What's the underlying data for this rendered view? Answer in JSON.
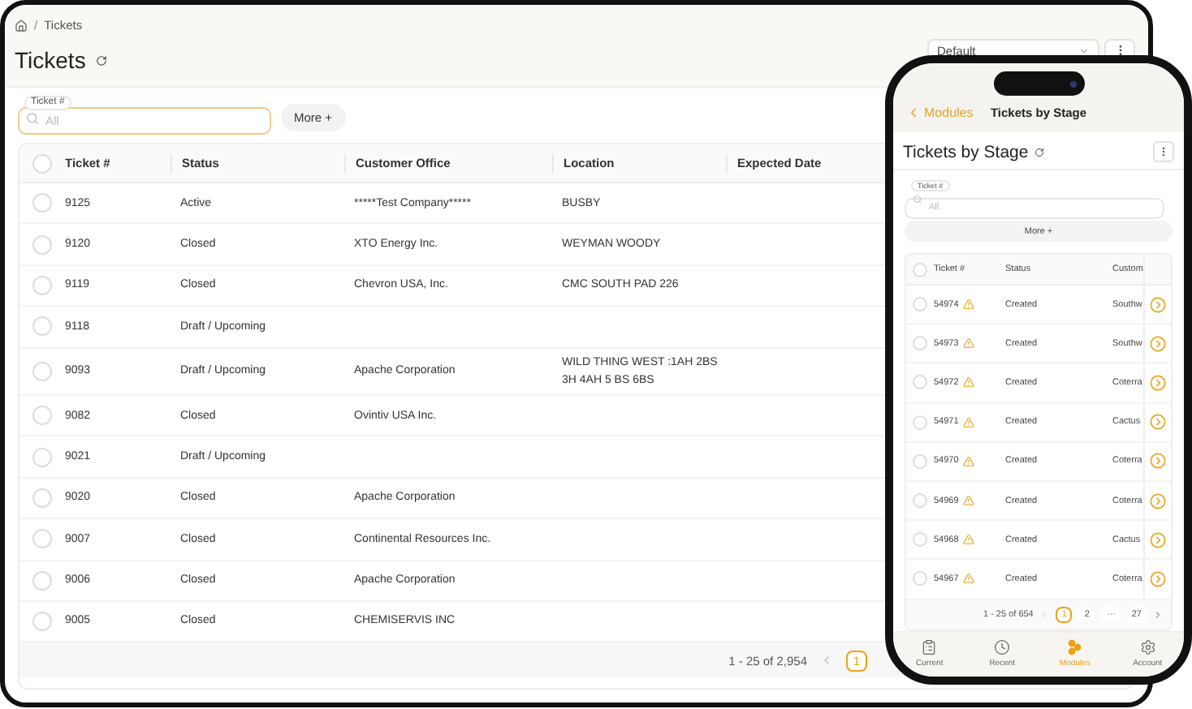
{
  "desktop": {
    "breadcrumb_separator": "/",
    "breadcrumb": [
      "Tickets"
    ],
    "title": "Tickets",
    "view_select": "Default",
    "search": {
      "label": "Ticket #",
      "placeholder": "All"
    },
    "more_button": "More +",
    "table": {
      "all_checked": false,
      "columns": [
        "Ticket #",
        "Status",
        "Customer Office",
        "Location",
        "Expected Date"
      ],
      "rows": [
        {
          "ticket": "9125",
          "status": "Active",
          "customer_office": "*****Test Company*****",
          "location": "BUSBY",
          "checked": false
        },
        {
          "ticket": "9120",
          "status": "Closed",
          "customer_office": "XTO Energy Inc.",
          "location": "WEYMAN WOODY",
          "checked": false
        },
        {
          "ticket": "9119",
          "status": "Closed",
          "customer_office": "Chevron USA, Inc.",
          "location": "CMC SOUTH PAD 226",
          "checked": false
        },
        {
          "ticket": "9118",
          "status": "Draft / Upcoming",
          "checked": false
        },
        {
          "ticket": "9093",
          "status": "Draft / Upcoming",
          "customer_office": "Apache Corporation",
          "location": "WILD THING WEST :1AH 2BS 3H 4AH 5 BS 6BS",
          "checked": false
        },
        {
          "ticket": "9082",
          "status": "Closed",
          "customer_office": "Ovintiv USA Inc.",
          "checked": false
        },
        {
          "ticket": "9021",
          "status": "Draft / Upcoming",
          "checked": false
        },
        {
          "ticket": "9020",
          "status": "Closed",
          "customer_office": "Apache Corporation",
          "checked": false
        },
        {
          "ticket": "9007",
          "status": "Closed",
          "customer_office": "Continental Resources Inc.",
          "checked": false
        },
        {
          "ticket": "9006",
          "status": "Closed",
          "customer_office": "Apache Corporation",
          "checked": false
        },
        {
          "ticket": "9005",
          "status": "Closed",
          "customer_office": "CHEMISERVIS INC",
          "checked": false
        }
      ]
    },
    "pagination": {
      "range": "1 - 25 of 2,954",
      "pages": [
        {
          "label": "1",
          "selected": true
        }
      ]
    }
  },
  "phone": {
    "back_link": "Modules",
    "nav_title": "Tickets by Stage",
    "title": "Tickets by Stage",
    "search": {
      "label": "Ticket #",
      "placeholder": "All"
    },
    "more_button": "More +",
    "table": {
      "all_checked": false,
      "columns": [
        "Ticket #",
        "Status",
        "Custom"
      ],
      "rows": [
        {
          "ticket": "54974",
          "warning": true,
          "status": "Created",
          "customer": "Southw",
          "checked": false
        },
        {
          "ticket": "54973",
          "warning": true,
          "status": "Created",
          "customer": "Southw",
          "checked": false
        },
        {
          "ticket": "54972",
          "warning": true,
          "status": "Created",
          "customer": "Coterra",
          "checked": false
        },
        {
          "ticket": "54971",
          "warning": true,
          "status": "Created",
          "customer": "Cactus",
          "checked": false
        },
        {
          "ticket": "54970",
          "warning": true,
          "status": "Created",
          "customer": "Coterra",
          "checked": false
        },
        {
          "ticket": "54969",
          "warning": true,
          "status": "Created",
          "customer": "Coterra",
          "checked": false
        },
        {
          "ticket": "54968",
          "warning": true,
          "status": "Created",
          "customer": "Cactus",
          "checked": false
        },
        {
          "ticket": "54967",
          "warning": true,
          "status": "Created",
          "customer": "Coterra",
          "checked": false
        }
      ]
    },
    "pagination": {
      "range": "1 - 25 of 654",
      "pages": [
        {
          "label": "1",
          "selected": true
        },
        {
          "label": "2",
          "selected": false
        },
        {
          "label": "···",
          "selected": false
        },
        {
          "label": "27",
          "selected": false
        }
      ]
    },
    "tabs": [
      {
        "label": "Current",
        "kind": "clipboard",
        "selected": false
      },
      {
        "label": "Recent",
        "kind": "clock",
        "selected": false
      },
      {
        "label": "Modules",
        "kind": "cluster",
        "selected": true
      },
      {
        "label": "Account",
        "kind": "gear",
        "selected": false
      }
    ]
  }
}
